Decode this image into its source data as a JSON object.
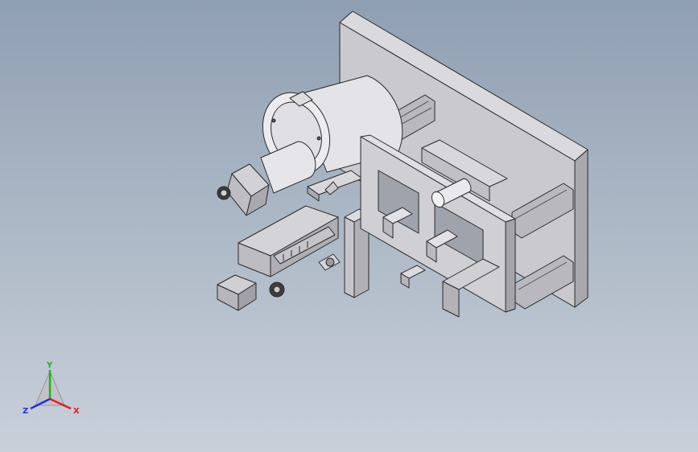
{
  "viewport": {
    "background_top": "#8f9fb2",
    "background_bottom": "#c9d0da"
  },
  "triad": {
    "x_label": "X",
    "y_label": "Y",
    "z_label": "Z",
    "x_color": "#e02020",
    "y_color": "#20b020",
    "z_color": "#2030e0"
  }
}
